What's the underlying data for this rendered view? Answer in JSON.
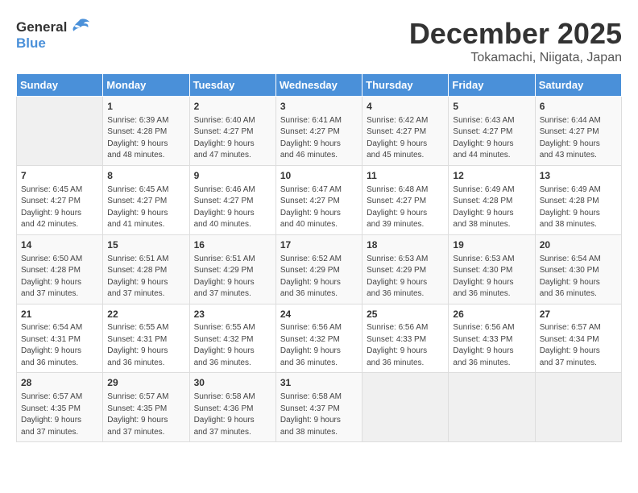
{
  "logo": {
    "general": "General",
    "blue": "Blue"
  },
  "title": "December 2025",
  "subtitle": "Tokamachi, Niigata, Japan",
  "days_of_week": [
    "Sunday",
    "Monday",
    "Tuesday",
    "Wednesday",
    "Thursday",
    "Friday",
    "Saturday"
  ],
  "weeks": [
    [
      {
        "day": "",
        "content": ""
      },
      {
        "day": "1",
        "content": "Sunrise: 6:39 AM\nSunset: 4:28 PM\nDaylight: 9 hours\nand 48 minutes."
      },
      {
        "day": "2",
        "content": "Sunrise: 6:40 AM\nSunset: 4:27 PM\nDaylight: 9 hours\nand 47 minutes."
      },
      {
        "day": "3",
        "content": "Sunrise: 6:41 AM\nSunset: 4:27 PM\nDaylight: 9 hours\nand 46 minutes."
      },
      {
        "day": "4",
        "content": "Sunrise: 6:42 AM\nSunset: 4:27 PM\nDaylight: 9 hours\nand 45 minutes."
      },
      {
        "day": "5",
        "content": "Sunrise: 6:43 AM\nSunset: 4:27 PM\nDaylight: 9 hours\nand 44 minutes."
      },
      {
        "day": "6",
        "content": "Sunrise: 6:44 AM\nSunset: 4:27 PM\nDaylight: 9 hours\nand 43 minutes."
      }
    ],
    [
      {
        "day": "7",
        "content": "Sunrise: 6:45 AM\nSunset: 4:27 PM\nDaylight: 9 hours\nand 42 minutes."
      },
      {
        "day": "8",
        "content": "Sunrise: 6:45 AM\nSunset: 4:27 PM\nDaylight: 9 hours\nand 41 minutes."
      },
      {
        "day": "9",
        "content": "Sunrise: 6:46 AM\nSunset: 4:27 PM\nDaylight: 9 hours\nand 40 minutes."
      },
      {
        "day": "10",
        "content": "Sunrise: 6:47 AM\nSunset: 4:27 PM\nDaylight: 9 hours\nand 40 minutes."
      },
      {
        "day": "11",
        "content": "Sunrise: 6:48 AM\nSunset: 4:27 PM\nDaylight: 9 hours\nand 39 minutes."
      },
      {
        "day": "12",
        "content": "Sunrise: 6:49 AM\nSunset: 4:28 PM\nDaylight: 9 hours\nand 38 minutes."
      },
      {
        "day": "13",
        "content": "Sunrise: 6:49 AM\nSunset: 4:28 PM\nDaylight: 9 hours\nand 38 minutes."
      }
    ],
    [
      {
        "day": "14",
        "content": "Sunrise: 6:50 AM\nSunset: 4:28 PM\nDaylight: 9 hours\nand 37 minutes."
      },
      {
        "day": "15",
        "content": "Sunrise: 6:51 AM\nSunset: 4:28 PM\nDaylight: 9 hours\nand 37 minutes."
      },
      {
        "day": "16",
        "content": "Sunrise: 6:51 AM\nSunset: 4:29 PM\nDaylight: 9 hours\nand 37 minutes."
      },
      {
        "day": "17",
        "content": "Sunrise: 6:52 AM\nSunset: 4:29 PM\nDaylight: 9 hours\nand 36 minutes."
      },
      {
        "day": "18",
        "content": "Sunrise: 6:53 AM\nSunset: 4:29 PM\nDaylight: 9 hours\nand 36 minutes."
      },
      {
        "day": "19",
        "content": "Sunrise: 6:53 AM\nSunset: 4:30 PM\nDaylight: 9 hours\nand 36 minutes."
      },
      {
        "day": "20",
        "content": "Sunrise: 6:54 AM\nSunset: 4:30 PM\nDaylight: 9 hours\nand 36 minutes."
      }
    ],
    [
      {
        "day": "21",
        "content": "Sunrise: 6:54 AM\nSunset: 4:31 PM\nDaylight: 9 hours\nand 36 minutes."
      },
      {
        "day": "22",
        "content": "Sunrise: 6:55 AM\nSunset: 4:31 PM\nDaylight: 9 hours\nand 36 minutes."
      },
      {
        "day": "23",
        "content": "Sunrise: 6:55 AM\nSunset: 4:32 PM\nDaylight: 9 hours\nand 36 minutes."
      },
      {
        "day": "24",
        "content": "Sunrise: 6:56 AM\nSunset: 4:32 PM\nDaylight: 9 hours\nand 36 minutes."
      },
      {
        "day": "25",
        "content": "Sunrise: 6:56 AM\nSunset: 4:33 PM\nDaylight: 9 hours\nand 36 minutes."
      },
      {
        "day": "26",
        "content": "Sunrise: 6:56 AM\nSunset: 4:33 PM\nDaylight: 9 hours\nand 36 minutes."
      },
      {
        "day": "27",
        "content": "Sunrise: 6:57 AM\nSunset: 4:34 PM\nDaylight: 9 hours\nand 37 minutes."
      }
    ],
    [
      {
        "day": "28",
        "content": "Sunrise: 6:57 AM\nSunset: 4:35 PM\nDaylight: 9 hours\nand 37 minutes."
      },
      {
        "day": "29",
        "content": "Sunrise: 6:57 AM\nSunset: 4:35 PM\nDaylight: 9 hours\nand 37 minutes."
      },
      {
        "day": "30",
        "content": "Sunrise: 6:58 AM\nSunset: 4:36 PM\nDaylight: 9 hours\nand 37 minutes."
      },
      {
        "day": "31",
        "content": "Sunrise: 6:58 AM\nSunset: 4:37 PM\nDaylight: 9 hours\nand 38 minutes."
      },
      {
        "day": "",
        "content": ""
      },
      {
        "day": "",
        "content": ""
      },
      {
        "day": "",
        "content": ""
      }
    ]
  ]
}
